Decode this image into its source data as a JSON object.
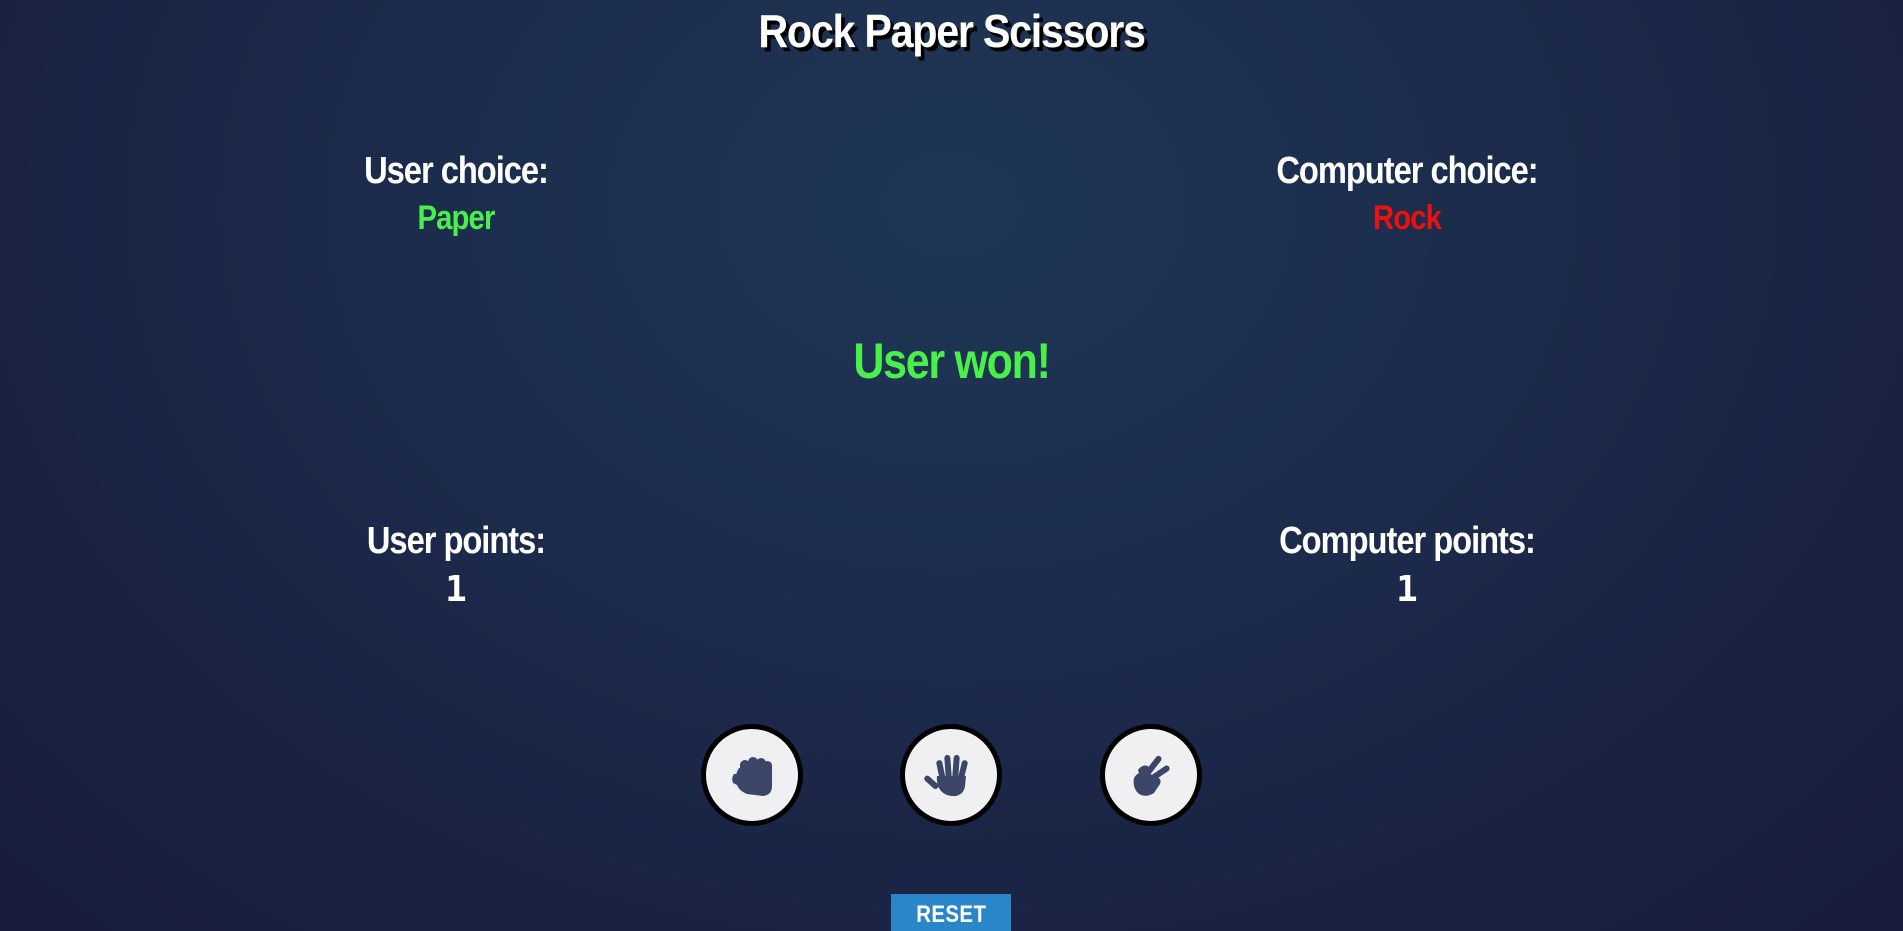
{
  "title": "Rock Paper Scissors",
  "user": {
    "choice_label": "User choice:",
    "choice_value": "Paper",
    "points_label": "User points:",
    "points_value": "1"
  },
  "computer": {
    "choice_label": "Computer choice:",
    "choice_value": "Rock",
    "points_label": "Computer points:",
    "points_value": "1"
  },
  "result": "User won!",
  "options": [
    {
      "name": "rock",
      "icon": "fist-icon"
    },
    {
      "name": "paper",
      "icon": "open-hand-icon"
    },
    {
      "name": "scissors",
      "icon": "scissors-hand-icon"
    }
  ],
  "reset_label": "RESET",
  "colors": {
    "win": "#4af04a",
    "lose": "#ee0f0f",
    "icon": "#3c4668",
    "button_bg": "#f0f0f2",
    "reset_bg": "#2a86c8"
  }
}
